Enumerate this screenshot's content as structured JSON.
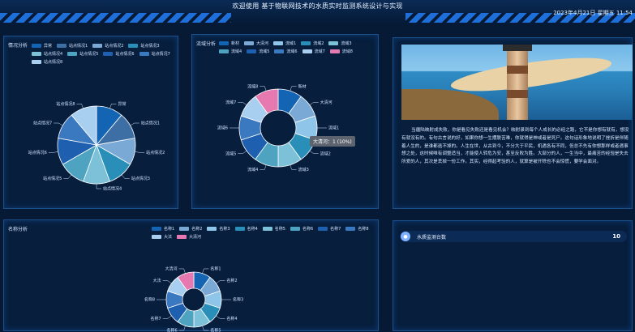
{
  "header": {
    "title": "欢迎使用 基于物联网技术的水质实时监测系统设计与实现",
    "datetime": "2023年4月21日 星期五 11:54"
  },
  "panels": {
    "status": {
      "title": "情况分析",
      "legend": [
        "异常",
        "站点情况1",
        "站点情况2",
        "站点情况3",
        "站点情况4",
        "站点情况5",
        "站点情况6",
        "站点情况7",
        "站点情况8"
      ]
    },
    "basin": {
      "title": "流域分析",
      "legend": [
        "新材",
        "大清河",
        "流域1",
        "流域2",
        "流域3",
        "流域4",
        "流域5",
        "流域6",
        "流域7",
        "流域8"
      ],
      "tooltip": "大清河：1 (10%)"
    },
    "intro": {
      "paragraph": "当疆陆映射成失败，你是看见失败还是看见机会？映射录到每个人成长的必经之路，它不是你想有就有，想没有就没有的。有句古言说的好，如果你想一生摆脱苦难，你就得是神或者是死尸。这句话形象地说明了挫折是伴随着人生的，是谁都逃不掉的。人生在世，从古到今，不分大于平民，机遇各有不同，但总不先有你想那样或者遇事想之处，这时候唯有调整适当，才能使人转危为安，甚至反败为胜。大部分的人，一生当中，最痛苦的经验是失去所爱的人，其次是丢掉一份工作。其实，经得起考验的人，就算是被开除也不会惊慌，要学会面对。"
    },
    "name": {
      "title": "名称分析",
      "legend": [
        "名称1",
        "名称2",
        "名称3",
        "名称4",
        "名称5",
        "名称6",
        "名称7",
        "名称8",
        "大法",
        "大清河"
      ]
    },
    "stats": {
      "label": "水质监测台数",
      "value": "10"
    }
  },
  "chart_data": [
    {
      "type": "pie",
      "title": "情况分析",
      "categories": [
        "异常",
        "站点情况1",
        "站点情况2",
        "站点情况3",
        "站点情况4",
        "站点情况5",
        "站点情况6",
        "站点情况7",
        "站点情况8"
      ],
      "values": [
        1,
        1,
        1,
        1,
        1,
        1,
        1,
        1,
        1
      ],
      "colors": [
        "#1464b4",
        "#3d6fa5",
        "#7aa9d6",
        "#2a8fb8",
        "#7cc1d8",
        "#4da3c0",
        "#1f5fb0",
        "#3a78c0",
        "#a9cff0"
      ]
    },
    {
      "type": "pie",
      "title": "流域分析",
      "categories": [
        "新材",
        "大清河",
        "流域1",
        "流域2",
        "流域3",
        "流域4",
        "流域5",
        "流域6",
        "流域7",
        "流域8"
      ],
      "values": [
        1,
        1,
        1,
        1,
        1,
        1,
        1,
        1,
        1,
        1
      ],
      "colors": [
        "#1464b4",
        "#7aa9d6",
        "#8ec5e8",
        "#2a8fb8",
        "#7cc1d8",
        "#4da3c0",
        "#1f5fb0",
        "#3a78c0",
        "#a9cff0",
        "#e67ab0"
      ]
    },
    {
      "type": "pie",
      "title": "名称分析",
      "categories": [
        "名称1",
        "名称2",
        "名称3",
        "名称4",
        "名称5",
        "名称6",
        "名称7",
        "名称8",
        "大法",
        "大清河"
      ],
      "values": [
        1,
        1,
        1,
        1,
        1,
        1,
        1,
        1,
        1,
        1
      ],
      "colors": [
        "#1464b4",
        "#7aa9d6",
        "#8ec5e8",
        "#2a8fb8",
        "#7cc1d8",
        "#4da3c0",
        "#1f5fb0",
        "#3a78c0",
        "#a9cff0",
        "#e67ab0"
      ]
    }
  ]
}
